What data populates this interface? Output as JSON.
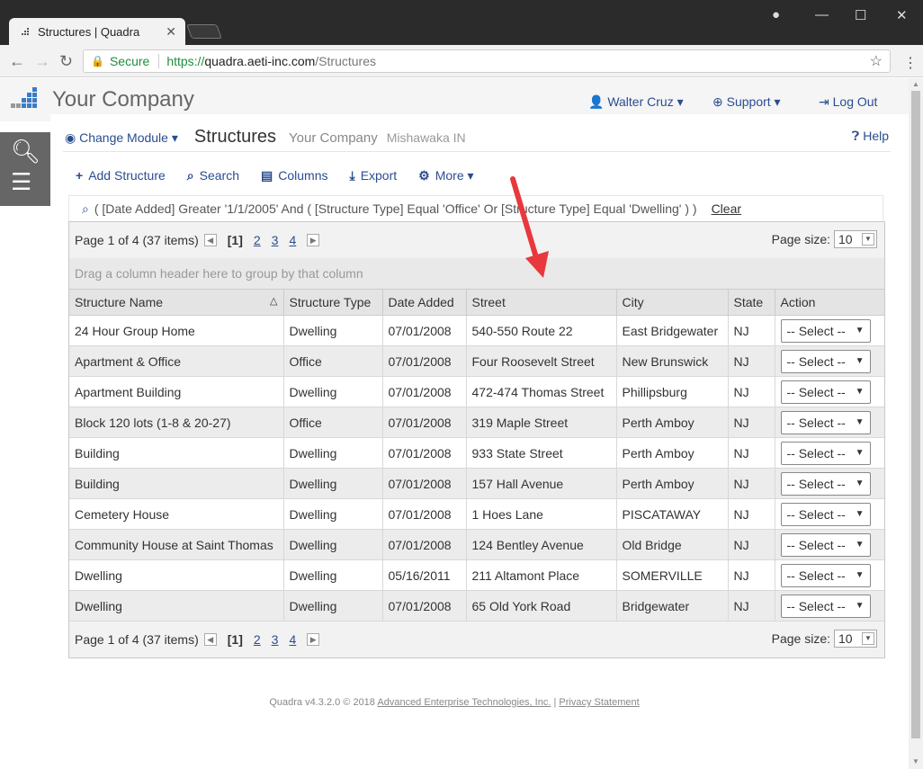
{
  "browser": {
    "tab_title": "Structures | Quadra",
    "secure_label": "Secure",
    "url_proto": "https://",
    "url_host": "quadra.aeti-inc.com",
    "url_path": "/Structures"
  },
  "header": {
    "company": "Your Company",
    "user": "Walter Cruz",
    "support": "Support",
    "logout": "Log Out"
  },
  "page": {
    "change_module": "Change Module",
    "title": "Structures",
    "company": "Your Company",
    "location": "Mishawaka IN",
    "help": "Help"
  },
  "actions": {
    "add": "Add Structure",
    "search": "Search",
    "columns": "Columns",
    "export": "Export",
    "more": "More"
  },
  "filter": {
    "text": "( [Date Added] Greater '1/1/2005' And ( [Structure Type] Equal 'Office' Or [Structure Type] Equal 'Dwelling' ) )",
    "clear": "Clear"
  },
  "pager": {
    "summary": "Page 1 of 4 (37 items)",
    "current": "[1]",
    "pages": [
      "2",
      "3",
      "4"
    ],
    "size_label": "Page size:",
    "size_value": "10"
  },
  "group_hint": "Drag a column header here to group by that column",
  "columns": [
    "Structure Name",
    "Structure Type",
    "Date Added",
    "Street",
    "City",
    "State",
    "Action"
  ],
  "rows": [
    [
      "24 Hour Group Home",
      "Dwelling",
      "07/01/2008",
      "540-550 Route 22",
      "East Bridgewater",
      "NJ"
    ],
    [
      "Apartment & Office",
      "Office",
      "07/01/2008",
      "Four Roosevelt Street",
      "New Brunswick",
      "NJ"
    ],
    [
      "Apartment Building",
      "Dwelling",
      "07/01/2008",
      "472-474 Thomas Street",
      "Phillipsburg",
      "NJ"
    ],
    [
      "Block 120 lots (1-8 & 20-27)",
      "Office",
      "07/01/2008",
      "319 Maple Street",
      "Perth Amboy",
      "NJ"
    ],
    [
      "Building",
      "Dwelling",
      "07/01/2008",
      "933 State Street",
      "Perth Amboy",
      "NJ"
    ],
    [
      "Building",
      "Dwelling",
      "07/01/2008",
      "157 Hall Avenue",
      "Perth Amboy",
      "NJ"
    ],
    [
      "Cemetery House",
      "Dwelling",
      "07/01/2008",
      "1 Hoes Lane",
      "PISCATAWAY",
      "NJ"
    ],
    [
      "Community House at Saint Thomas",
      "Dwelling",
      "07/01/2008",
      "124 Bentley Avenue",
      "Old Bridge",
      "NJ"
    ],
    [
      "Dwelling",
      "Dwelling",
      "05/16/2011",
      "211 Altamont Place",
      "SOMERVILLE",
      "NJ"
    ],
    [
      "Dwelling",
      "Dwelling",
      "07/01/2008",
      "65 Old York Road",
      "Bridgewater",
      "NJ"
    ]
  ],
  "row_action": "-- Select --",
  "footer": {
    "version": "Quadra v4.3.2.0 © 2018",
    "company_link": "Advanced Enterprise Technologies, Inc.",
    "sep": "|",
    "privacy": "Privacy Statement"
  },
  "colors": {
    "link": "#2a4d8f",
    "annotation_arrow": "#e8383d"
  }
}
